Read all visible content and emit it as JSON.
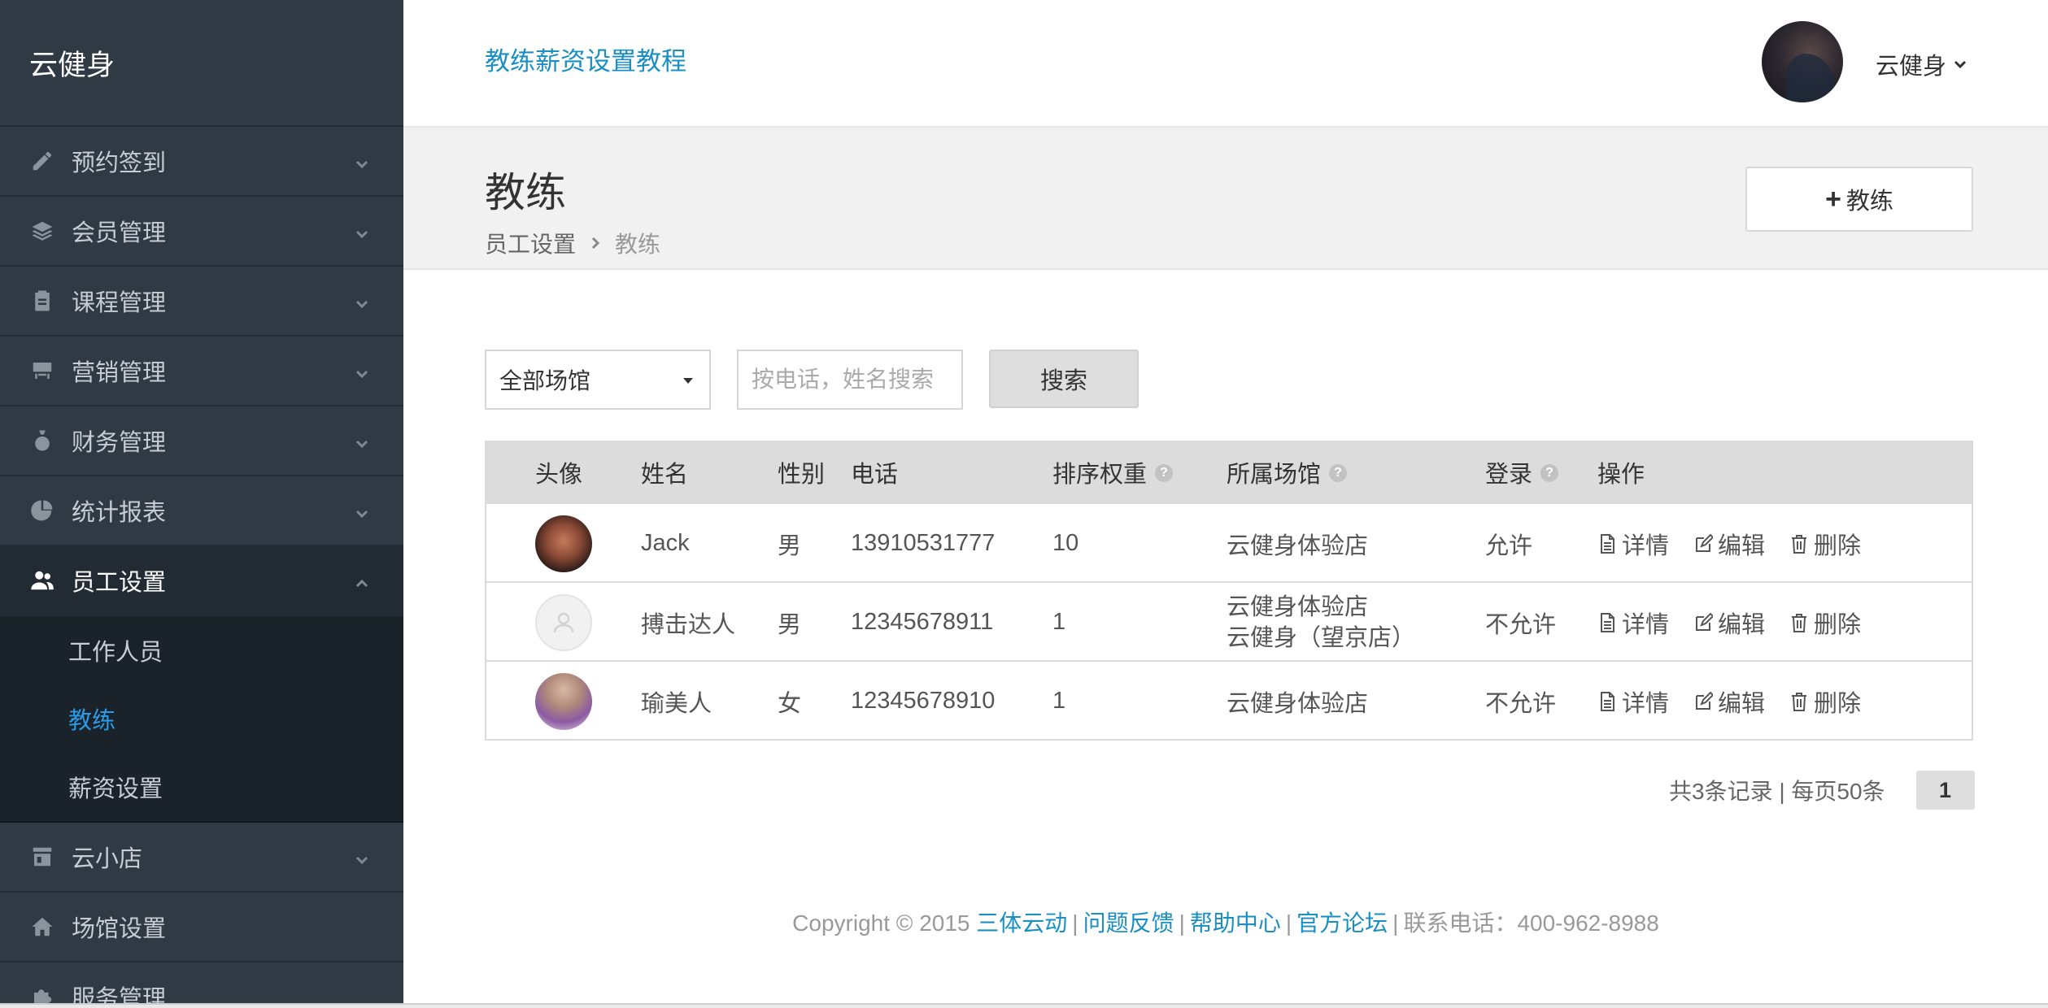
{
  "brand": "云健身",
  "sidebar": {
    "items_before": [
      {
        "label": "预约签到",
        "icon": "pencil-icon"
      },
      {
        "label": "会员管理",
        "icon": "layers-icon"
      },
      {
        "label": "课程管理",
        "icon": "clipboard-icon"
      },
      {
        "label": "营销管理",
        "icon": "store-icon"
      },
      {
        "label": "财务管理",
        "icon": "money-bag-icon"
      },
      {
        "label": "统计报表",
        "icon": "pie-chart-icon"
      }
    ],
    "active": {
      "label": "员工设置",
      "icon": "users-icon"
    },
    "submenu": [
      {
        "label": "工作人员"
      },
      {
        "label": "教练"
      },
      {
        "label": "薪资设置"
      }
    ],
    "items_after": [
      {
        "label": "云小店",
        "icon": "shop-icon"
      },
      {
        "label": "场馆设置",
        "icon": "home-icon"
      },
      {
        "label": "服务管理",
        "icon": "puzzle-icon"
      }
    ]
  },
  "header": {
    "tutorial_link": "教练薪资设置教程",
    "user_name": "云健身"
  },
  "page": {
    "title": "教练",
    "breadcrumb": [
      "员工设置",
      "教练"
    ],
    "add_button": "教练"
  },
  "filters": {
    "venue_select": "全部场馆",
    "search_placeholder": "按电话，姓名搜索",
    "search_button": "搜索"
  },
  "table": {
    "headers": {
      "avatar": "头像",
      "name": "姓名",
      "gender": "性别",
      "phone": "电话",
      "weight": "排序权重",
      "venue": "所属场馆",
      "login": "登录",
      "ops": "操作"
    },
    "help_glyph": "?",
    "ops_labels": {
      "detail": "详情",
      "edit": "编辑",
      "delete": "删除"
    },
    "rows": [
      {
        "name": "Jack",
        "gender": "男",
        "phone": "13910531777",
        "weight": "10",
        "venue": "云健身体验店",
        "venue2": "",
        "login": "允许"
      },
      {
        "name": "搏击达人",
        "gender": "男",
        "phone": "12345678911",
        "weight": "1",
        "venue": "云健身体验店",
        "venue2": "云健身（望京店）",
        "login": "不允许"
      },
      {
        "name": "瑜美人",
        "gender": "女",
        "phone": "12345678910",
        "weight": "1",
        "venue": "云健身体验店",
        "venue2": "",
        "login": "不允许"
      }
    ]
  },
  "pagination": {
    "summary": "共3条记录 | 每页50条",
    "current": "1"
  },
  "footer": {
    "copyright": "Copyright © 2015",
    "links": [
      "三体云动",
      "问题反馈",
      "帮助中心",
      "官方论坛"
    ],
    "phone": "联系电话：400-962-8988"
  }
}
